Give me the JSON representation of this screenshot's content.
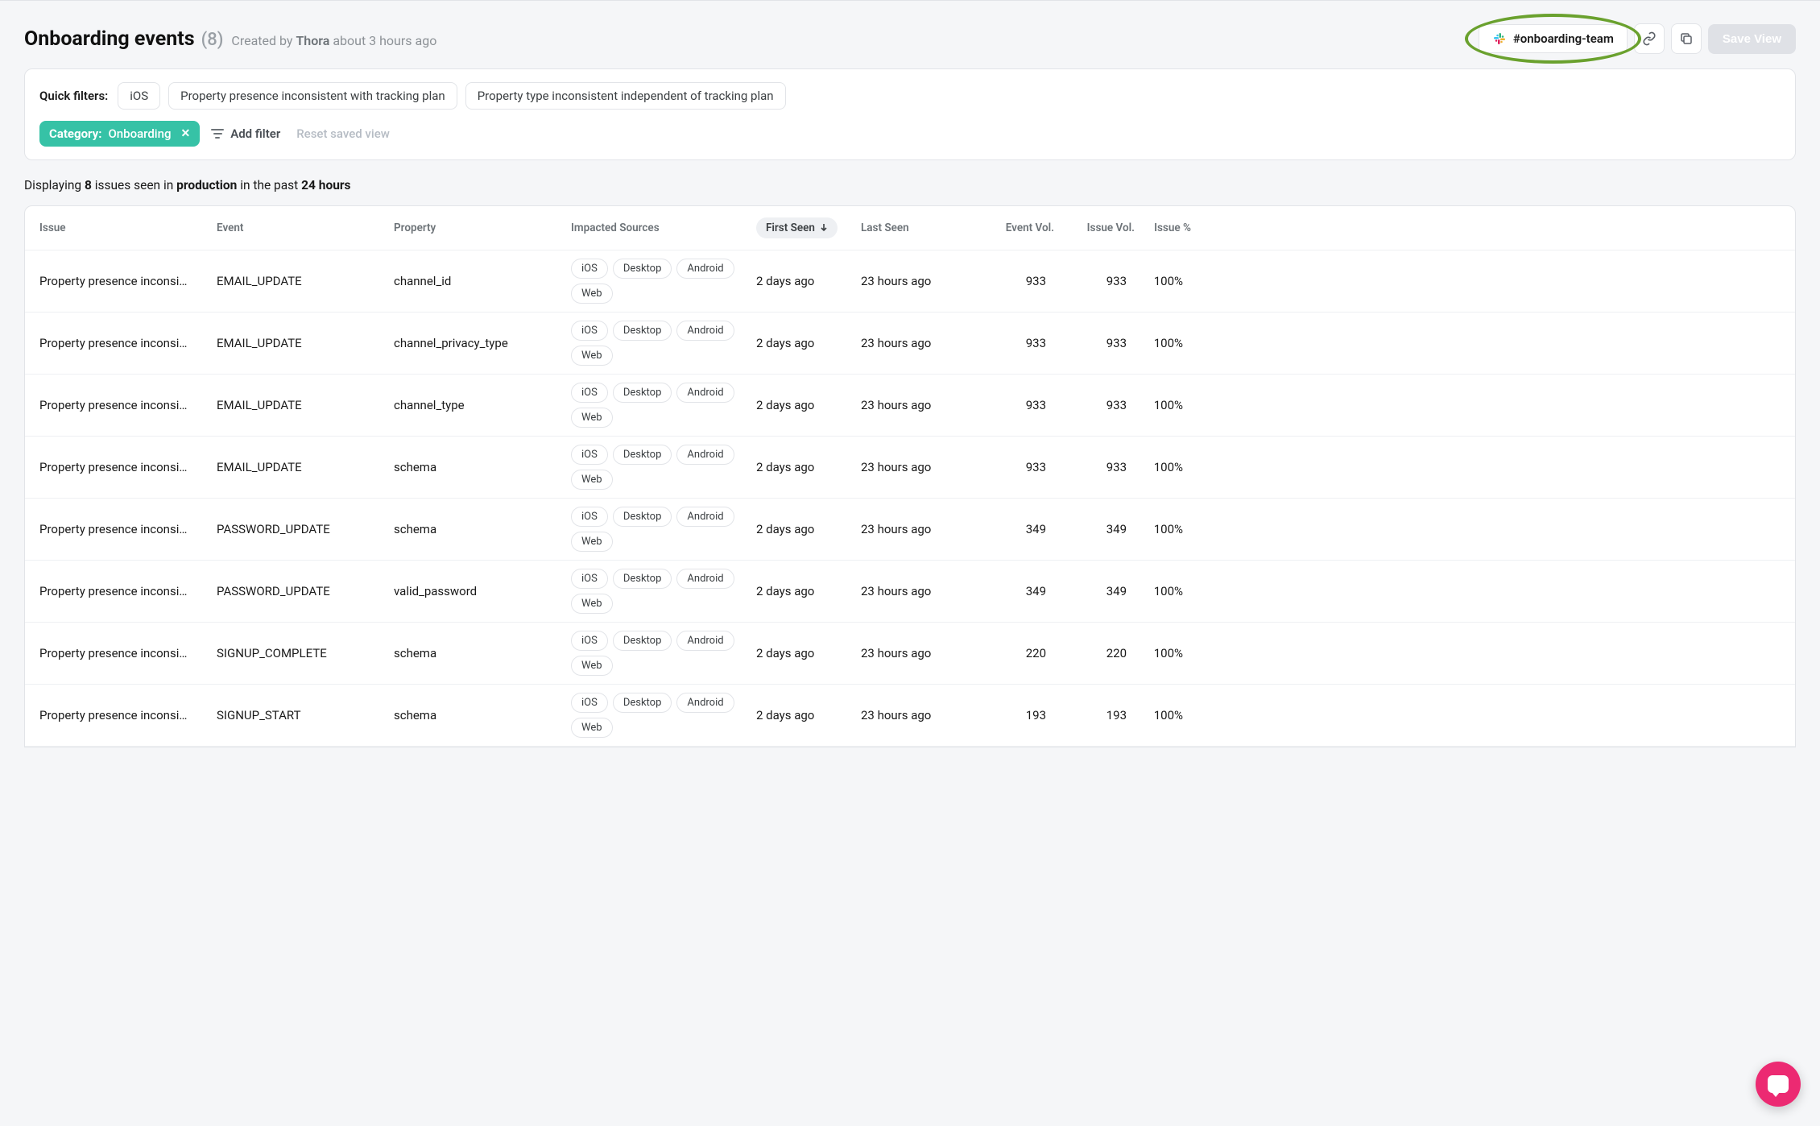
{
  "header": {
    "title": "Onboarding events",
    "count": "(8)",
    "created_prefix": "Created by",
    "author": "Thora",
    "created_suffix": "about 3 hours ago",
    "slack_channel": "#onboarding-team",
    "save_label": "Save View"
  },
  "filters": {
    "label": "Quick filters:",
    "quick": [
      "iOS",
      "Property presence inconsistent with tracking plan",
      "Property type inconsistent independent of tracking plan"
    ],
    "active_label": "Category:",
    "active_value": "Onboarding",
    "add_label": "Add filter",
    "reset_label": "Reset saved view"
  },
  "summary": {
    "prefix": "Displaying",
    "count": "8",
    "mid1": "issues seen in",
    "env": "production",
    "mid2": "in the past",
    "window": "24 hours"
  },
  "table": {
    "headers": {
      "issue": "Issue",
      "event": "Event",
      "property": "Property",
      "impacted": "Impacted Sources",
      "first_seen": "First Seen",
      "last_seen": "Last Seen",
      "event_vol": "Event Vol.",
      "issue_vol": "Issue Vol.",
      "issue_pct": "Issue %"
    },
    "rows": [
      {
        "issue": "Property presence inconsi…",
        "event": "EMAIL_UPDATE",
        "property": "channel_id",
        "sources": [
          "iOS",
          "Desktop",
          "Android",
          "Web"
        ],
        "first": "2 days ago",
        "last": "23 hours ago",
        "ev": "933",
        "iv": "933",
        "pct": "100%"
      },
      {
        "issue": "Property presence inconsi…",
        "event": "EMAIL_UPDATE",
        "property": "channel_privacy_type",
        "sources": [
          "iOS",
          "Desktop",
          "Android",
          "Web"
        ],
        "first": "2 days ago",
        "last": "23 hours ago",
        "ev": "933",
        "iv": "933",
        "pct": "100%"
      },
      {
        "issue": "Property presence inconsi…",
        "event": "EMAIL_UPDATE",
        "property": "channel_type",
        "sources": [
          "iOS",
          "Desktop",
          "Android",
          "Web"
        ],
        "first": "2 days ago",
        "last": "23 hours ago",
        "ev": "933",
        "iv": "933",
        "pct": "100%"
      },
      {
        "issue": "Property presence inconsi…",
        "event": "EMAIL_UPDATE",
        "property": "schema",
        "sources": [
          "iOS",
          "Desktop",
          "Android",
          "Web"
        ],
        "first": "2 days ago",
        "last": "23 hours ago",
        "ev": "933",
        "iv": "933",
        "pct": "100%"
      },
      {
        "issue": "Property presence inconsi…",
        "event": "PASSWORD_UPDATE",
        "property": "schema",
        "sources": [
          "iOS",
          "Desktop",
          "Android",
          "Web"
        ],
        "first": "2 days ago",
        "last": "23 hours ago",
        "ev": "349",
        "iv": "349",
        "pct": "100%"
      },
      {
        "issue": "Property presence inconsi…",
        "event": "PASSWORD_UPDATE",
        "property": "valid_password",
        "sources": [
          "iOS",
          "Desktop",
          "Android",
          "Web"
        ],
        "first": "2 days ago",
        "last": "23 hours ago",
        "ev": "349",
        "iv": "349",
        "pct": "100%"
      },
      {
        "issue": "Property presence inconsi…",
        "event": "SIGNUP_COMPLETE",
        "property": "schema",
        "sources": [
          "iOS",
          "Desktop",
          "Android",
          "Web"
        ],
        "first": "2 days ago",
        "last": "23 hours ago",
        "ev": "220",
        "iv": "220",
        "pct": "100%"
      },
      {
        "issue": "Property presence inconsi…",
        "event": "SIGNUP_START",
        "property": "schema",
        "sources": [
          "iOS",
          "Desktop",
          "Android",
          "Web"
        ],
        "first": "2 days ago",
        "last": "23 hours ago",
        "ev": "193",
        "iv": "193",
        "pct": "100%"
      }
    ]
  }
}
